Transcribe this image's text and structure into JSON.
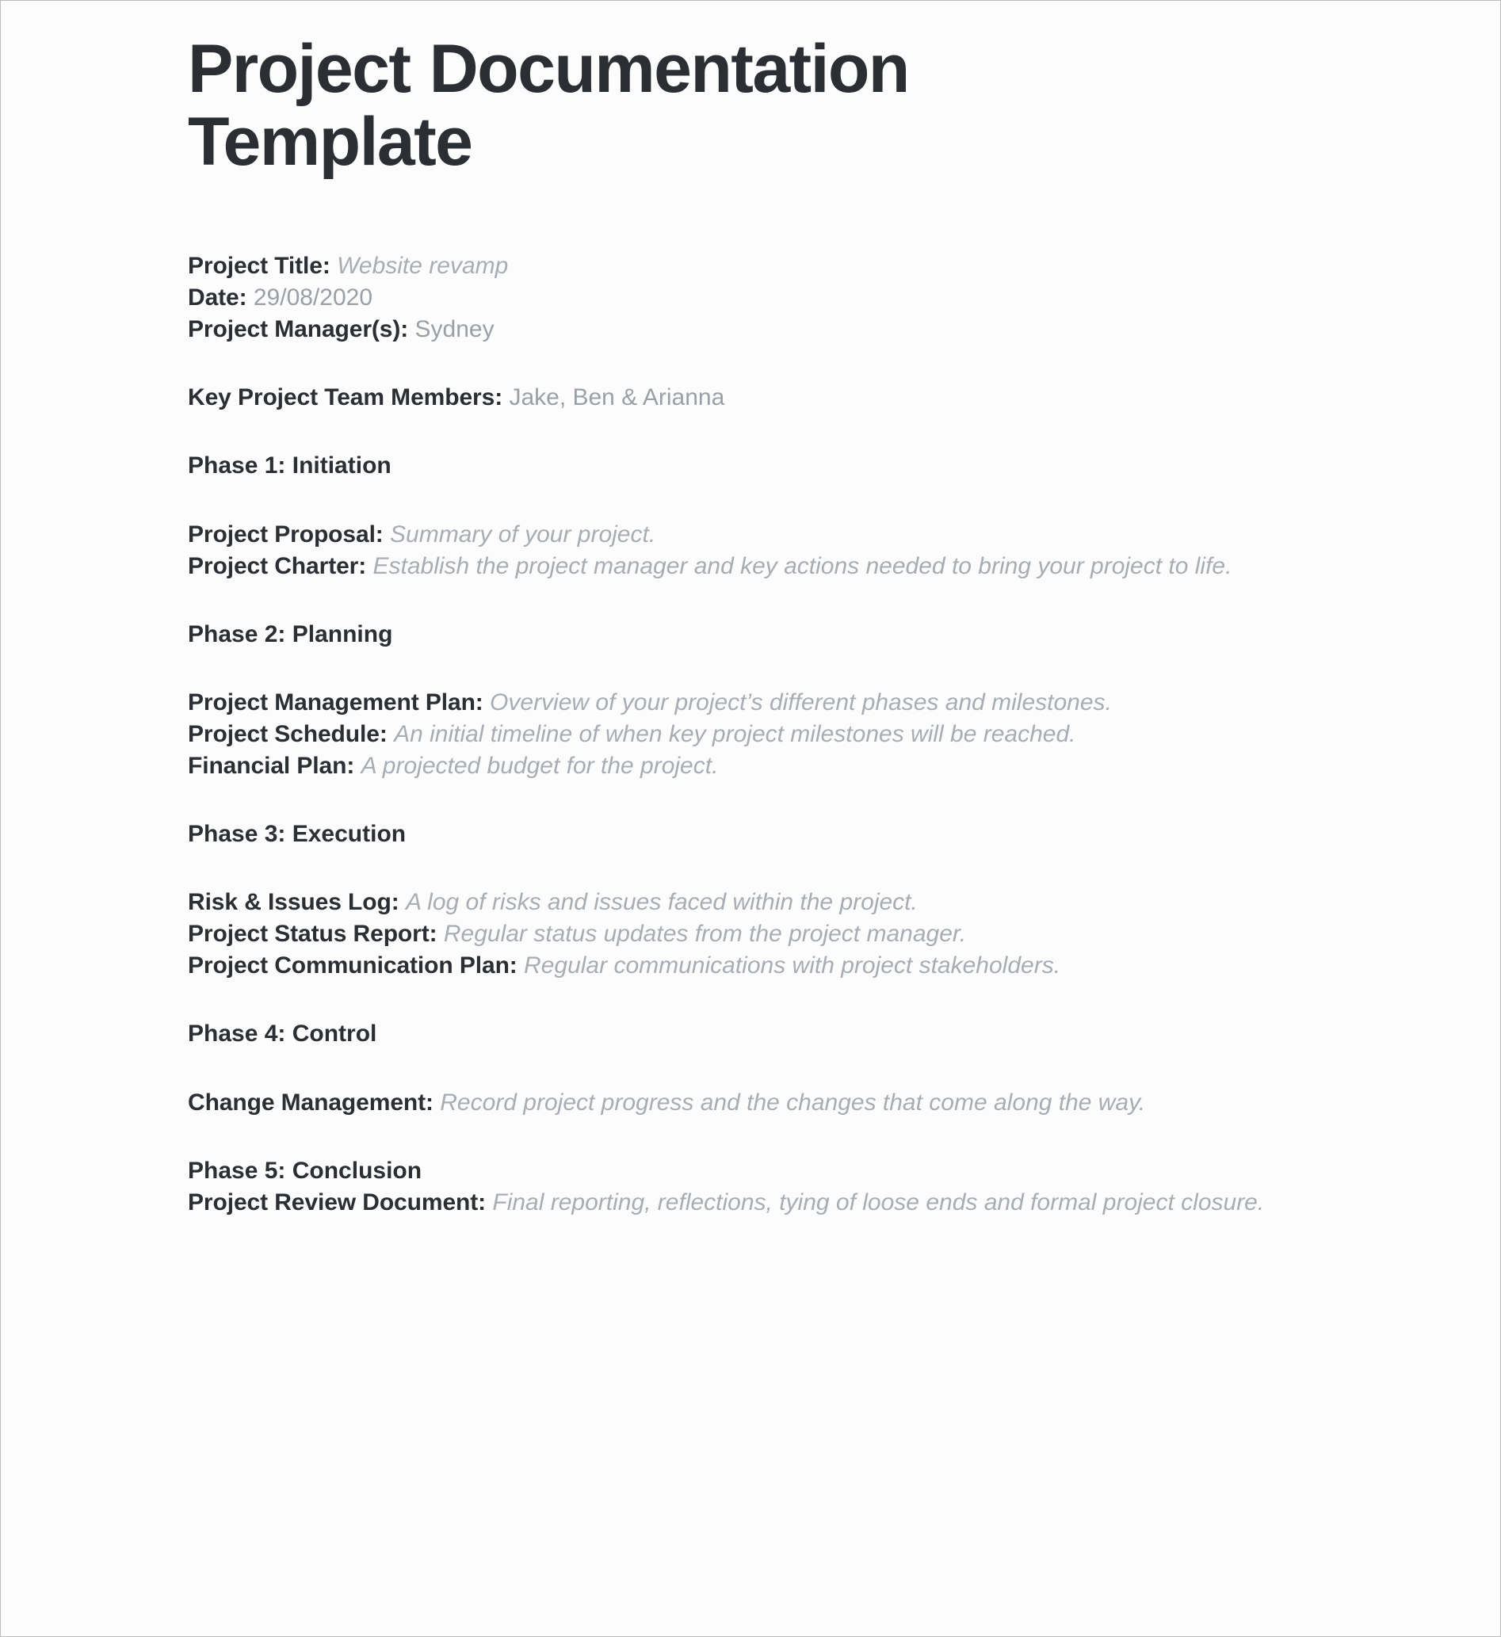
{
  "document": {
    "title": "Project Documentation Template",
    "meta_fields": [
      {
        "label": "Project Title:",
        "value": "Website revamp",
        "style": "italic"
      },
      {
        "label": "Date:",
        "value": "29/08/2020",
        "style": "upright"
      },
      {
        "label": "Project Manager(s):",
        "value": "Sydney",
        "style": "upright"
      }
    ],
    "team": {
      "label": "Key Project Team Members:",
      "value": "Jake, Ben & Arianna"
    },
    "phases": [
      {
        "heading": "Phase 1: Initiation",
        "items": [
          {
            "label": "Project Proposal:",
            "text": "Summary of your project."
          },
          {
            "label": "Project Charter:",
            "text": "Establish the project manager and key actions needed to bring your project to life."
          }
        ]
      },
      {
        "heading": "Phase 2: Planning",
        "items": [
          {
            "label": "Project Management Plan:",
            "text": "Overview of your project’s different phases and milestones."
          },
          {
            "label": "Project Schedule:",
            "text": "An initial timeline of when key project milestones will be reached."
          },
          {
            "label": "Financial Plan:",
            "text": "A projected budget for the project."
          }
        ]
      },
      {
        "heading": "Phase 3: Execution",
        "items": [
          {
            "label": "Risk & Issues Log:",
            "text": "A log of risks and issues faced within the project."
          },
          {
            "label": "Project Status Report:",
            "text": "Regular status updates from the project manager."
          },
          {
            "label": "Project Communication Plan:",
            "text": "Regular communications with project stakeholders."
          }
        ]
      },
      {
        "heading": "Phase 4: Control",
        "items": [
          {
            "label": "Change Management:",
            "text": "Record project progress and the changes that come along the way."
          }
        ]
      },
      {
        "heading": "Phase 5: Conclusion",
        "items": [
          {
            "label": "Project Review Document:",
            "text": "Final reporting, reflections, tying of loose ends and formal project closure."
          }
        ]
      }
    ]
  },
  "colors": {
    "text": "#2b2f33",
    "muted": "#9aa0a6",
    "placeholder": "#a8adb3",
    "rule": "#b6bbc0",
    "page": "#fcfcfc",
    "border": "#bdbdbd"
  }
}
